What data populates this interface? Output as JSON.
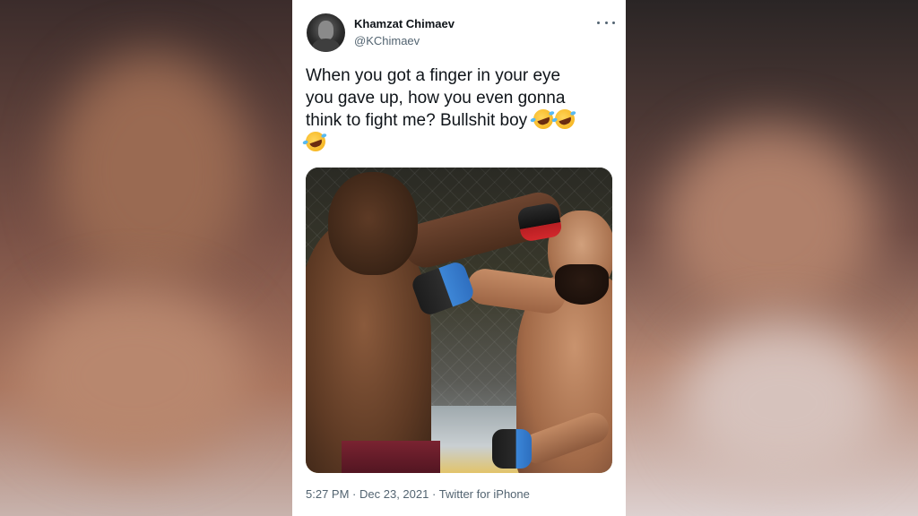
{
  "tweet": {
    "author": {
      "display_name": "Khamzat Chimaev",
      "handle": "@KChimaev"
    },
    "text_lines": [
      "When you got a finger in your eye",
      "you gave up, how you even gonna",
      "think to fight me? Bullshit boy"
    ],
    "emojis": [
      "rolling-on-floor-laughing-emoji",
      "rolling-on-floor-laughing-emoji",
      "rolling-on-floor-laughing-emoji"
    ],
    "media": {
      "kind": "photo"
    },
    "meta": {
      "time": "5:27 PM",
      "separator": "·",
      "date": "Dec 23, 2021",
      "source": "Twitter for iPhone"
    },
    "more_icon": "more-horizontal-icon"
  },
  "colors": {
    "text_primary": "#0f1419",
    "text_secondary": "#536471",
    "card_background": "#ffffff"
  }
}
